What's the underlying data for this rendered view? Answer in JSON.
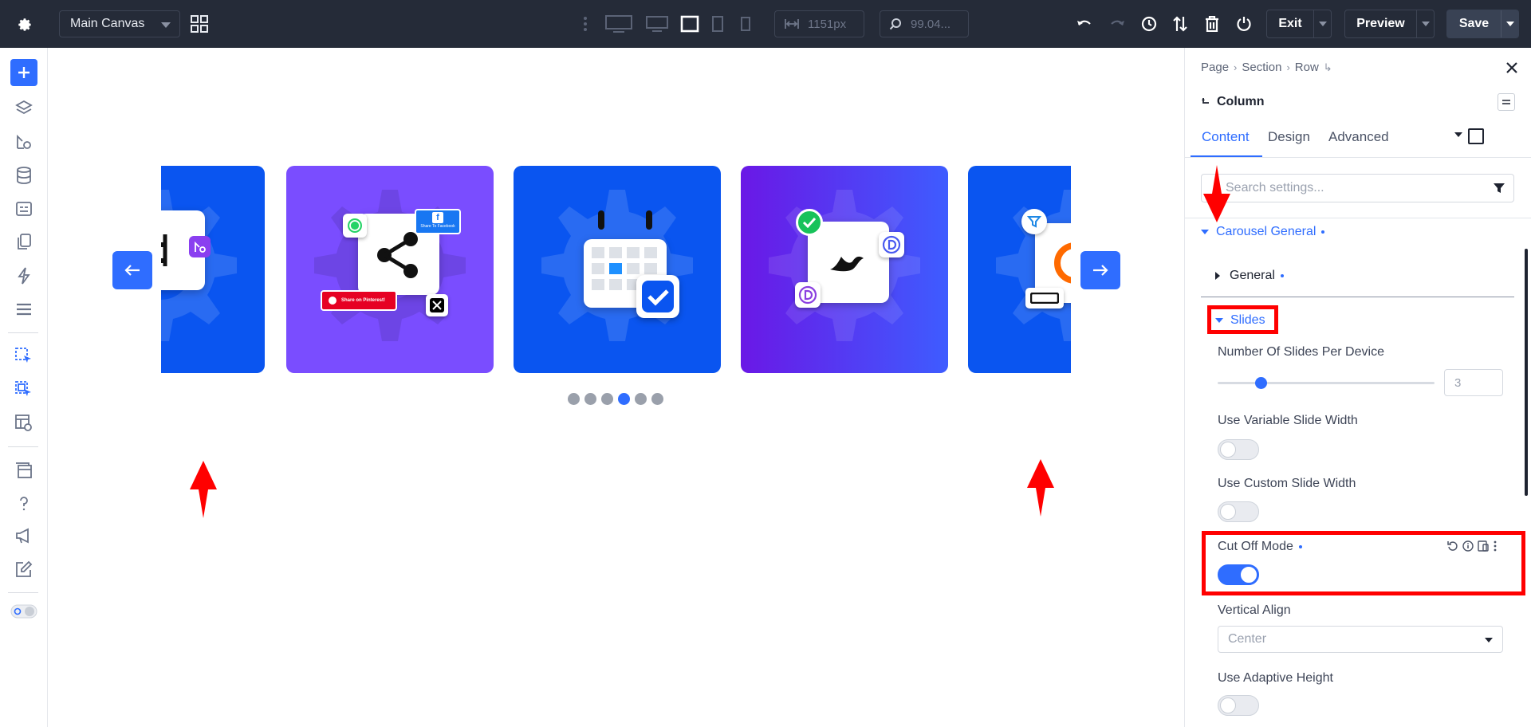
{
  "topbar": {
    "canvas_select": "Main Canvas",
    "width_value": "1151px",
    "zoom_value": "99.04...",
    "exit_label": "Exit",
    "preview_label": "Preview",
    "save_label": "Save"
  },
  "carousel": {
    "dots_count": 6,
    "active_dot": 3,
    "slides": [
      {
        "name": "slide-partial-left"
      },
      {
        "name": "slide-social-share",
        "share_facebook": "Share To Facebook",
        "share_pinterest": "Share on Pinterest!"
      },
      {
        "name": "slide-calendar"
      },
      {
        "name": "slide-divi-check"
      },
      {
        "name": "slide-partial-right"
      }
    ]
  },
  "panel": {
    "breadcrumb": [
      "Page",
      "Section",
      "Row"
    ],
    "module_title": "Column",
    "tabs": [
      "Content",
      "Design",
      "Advanced"
    ],
    "active_tab": "Content",
    "search_placeholder": "Search settings...",
    "group_title": "Carousel General",
    "subgroup_general": "General",
    "subgroup_slides": "Slides",
    "fields": {
      "slides_per_device_label": "Number Of Slides Per Device",
      "slides_per_device_value": "3",
      "variable_width_label": "Use Variable Slide Width",
      "custom_width_label": "Use Custom Slide Width",
      "cutoff_label": "Cut Off Mode",
      "vertical_align_label": "Vertical Align",
      "vertical_align_value": "Center",
      "adaptive_height_label": "Use Adaptive Height"
    },
    "slider_fraction": 0.2
  },
  "colors": {
    "topbar": "#252b38",
    "accent": "#2f6dff",
    "annotation_red": "#ff0000"
  }
}
